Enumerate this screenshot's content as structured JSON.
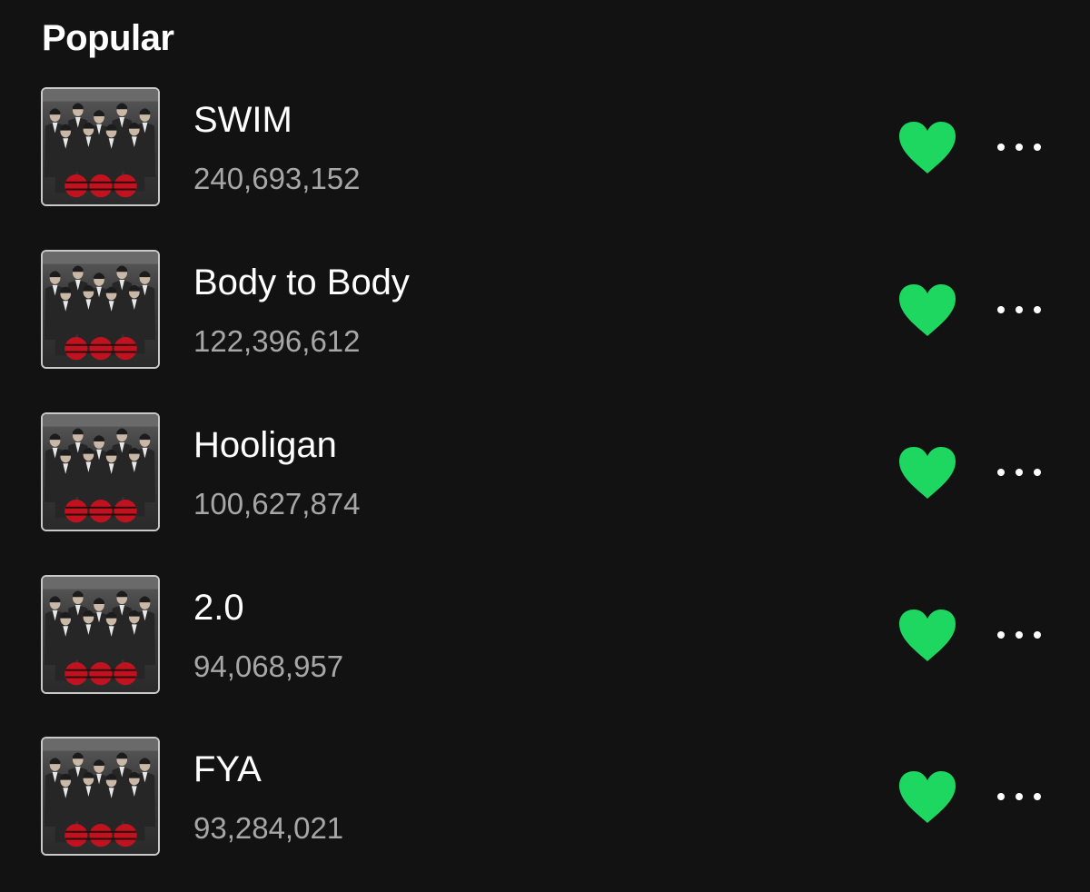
{
  "section": {
    "title": "Popular"
  },
  "colors": {
    "background": "#121212",
    "liked_accent": "#1ed760",
    "secondary_text": "#a7a7a7"
  },
  "icons": {
    "like": "heart-filled-icon",
    "more": "more-options-icon"
  },
  "tracks": [
    {
      "title": "SWIM",
      "plays": "240,693,152",
      "liked": true
    },
    {
      "title": "Body to Body",
      "plays": "122,396,612",
      "liked": true
    },
    {
      "title": "Hooligan",
      "plays": "100,627,874",
      "liked": true
    },
    {
      "title": "2.0",
      "plays": "94,068,957",
      "liked": true
    },
    {
      "title": "FYA",
      "plays": "93,284,021",
      "liked": true
    }
  ]
}
